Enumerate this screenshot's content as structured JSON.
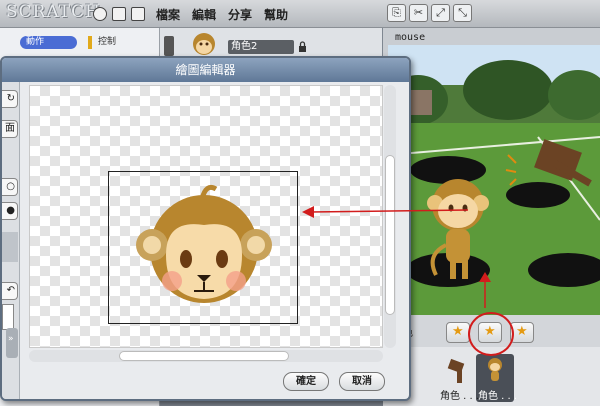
{
  "app": {
    "logo": "SCRATCH",
    "menu": [
      "檔案",
      "編輯",
      "分享",
      "幫助"
    ]
  },
  "palette": {
    "category_motion": "動作",
    "category_control": "控制"
  },
  "sprite": {
    "name": "角色2"
  },
  "stage": {
    "label": "mouse"
  },
  "stage_bottom": {
    "new_sprite_label": "角色"
  },
  "sprite_list": {
    "items": [
      {
        "label": "角色 . . ."
      },
      {
        "label": "角色 . . ."
      }
    ]
  },
  "dialog": {
    "title": "繪圖編輯器",
    "ok_label": "確定",
    "cancel_label": "取消",
    "side_tool_text": "面"
  },
  "colors": {
    "annotation": "#d21c1c",
    "title_bar": "#6f86a4",
    "motion_category": "#4a6cd4",
    "control_category": "#e1a91a"
  }
}
